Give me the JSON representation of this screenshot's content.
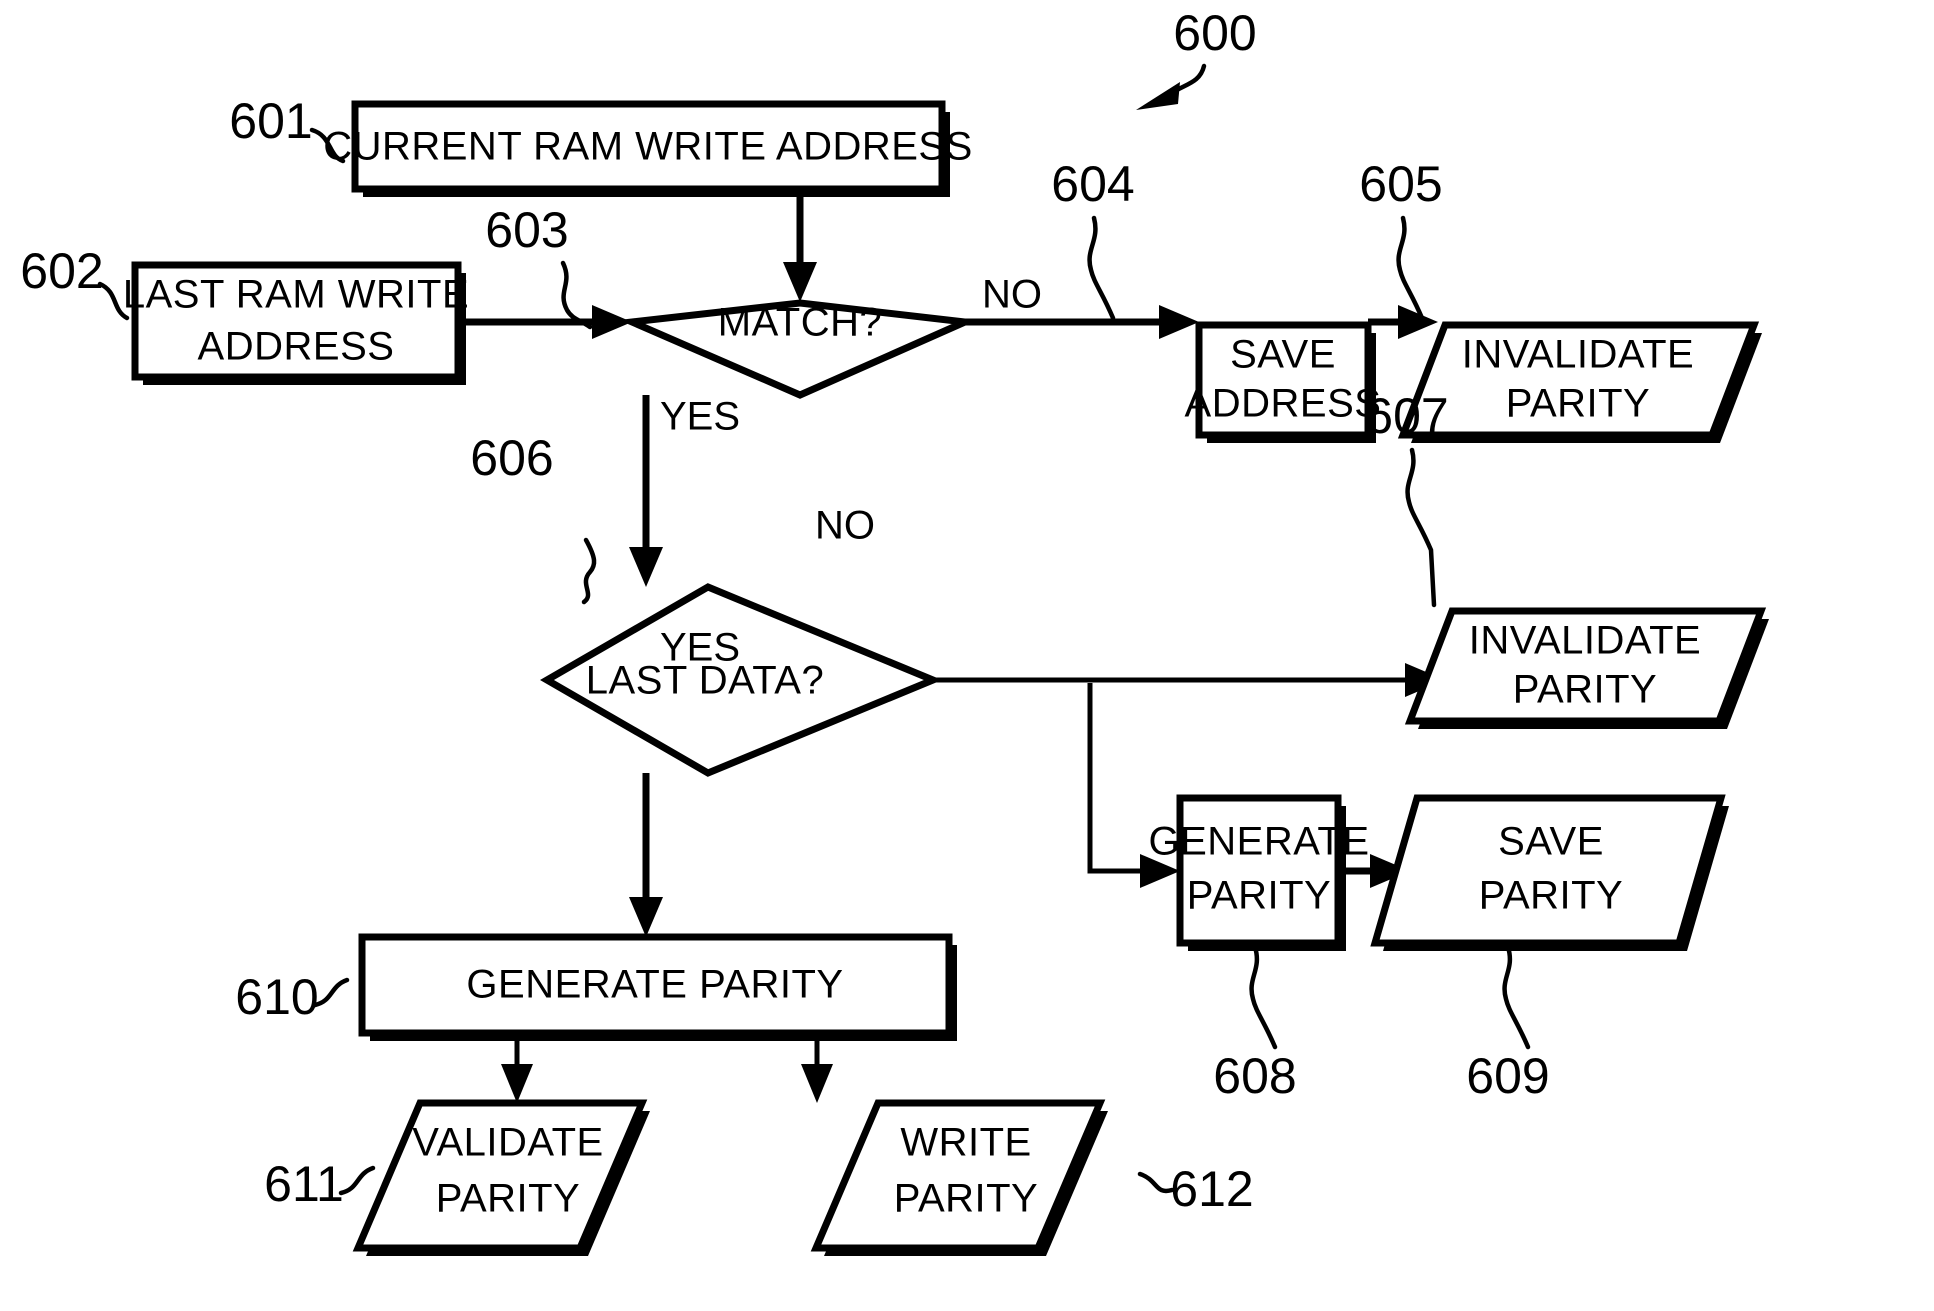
{
  "figure": {
    "ref": "600",
    "title_ref_label": "600"
  },
  "nodes": [
    {
      "id": "601",
      "ref": "601",
      "shape": "process",
      "lines": [
        "CURRENT RAM WRITE ADDRESS"
      ]
    },
    {
      "id": "602",
      "ref": "602",
      "shape": "process",
      "lines": [
        "LAST RAM WRITE",
        "ADDRESS"
      ]
    },
    {
      "id": "603",
      "ref": "603",
      "shape": "decision",
      "lines": [
        "MATCH?"
      ]
    },
    {
      "id": "604",
      "ref": "604",
      "shape": "process",
      "lines": [
        "SAVE",
        "ADDRESS"
      ]
    },
    {
      "id": "605",
      "ref": "605",
      "shape": "data",
      "lines": [
        "INVALIDATE",
        "PARITY"
      ]
    },
    {
      "id": "606",
      "ref": "606",
      "shape": "decision",
      "lines": [
        "LAST DATA?"
      ]
    },
    {
      "id": "607",
      "ref": "607",
      "shape": "data",
      "lines": [
        "INVALIDATE",
        "PARITY"
      ]
    },
    {
      "id": "608",
      "ref": "608",
      "shape": "process",
      "lines": [
        "GENERATE",
        "PARITY"
      ]
    },
    {
      "id": "609",
      "ref": "609",
      "shape": "data",
      "lines": [
        "SAVE",
        "PARITY"
      ]
    },
    {
      "id": "610",
      "ref": "610",
      "shape": "process",
      "lines": [
        "GENERATE PARITY"
      ]
    },
    {
      "id": "611",
      "ref": "611",
      "shape": "data",
      "lines": [
        "VALIDATE",
        "PARITY"
      ]
    },
    {
      "id": "612",
      "ref": "612",
      "shape": "data",
      "lines": [
        "WRITE",
        "PARITY"
      ]
    }
  ],
  "branch_labels": {
    "match_no": "NO",
    "match_yes": "YES",
    "lastdata_no": "NO",
    "lastdata_yes": "YES"
  },
  "node_text": {
    "n601_l1": "CURRENT RAM WRITE ADDRESS",
    "n602_l1": "LAST RAM WRITE",
    "n602_l2": "ADDRESS",
    "n603_l1": "MATCH?",
    "n604_l1": "SAVE",
    "n604_l2": "ADDRESS",
    "n605_l1": "INVALIDATE",
    "n605_l2": "PARITY",
    "n606_l1": "LAST DATA?",
    "n607_l1": "INVALIDATE",
    "n607_l2": "PARITY",
    "n608_l1": "GENERATE",
    "n608_l2": "PARITY",
    "n609_l1": "SAVE",
    "n609_l2": "PARITY",
    "n610_l1": "GENERATE PARITY",
    "n611_l1": "VALIDATE",
    "n611_l2": "PARITY",
    "n612_l1": "WRITE",
    "n612_l2": "PARITY"
  },
  "ref_numbers": {
    "r600": "600",
    "r601": "601",
    "r602": "602",
    "r603": "603",
    "r604": "604",
    "r605": "605",
    "r606": "606",
    "r607": "607",
    "r608": "608",
    "r609": "609",
    "r610": "610",
    "r611": "611",
    "r612": "612"
  },
  "colors": {
    "ink": "#000000",
    "paper": "#ffffff"
  }
}
